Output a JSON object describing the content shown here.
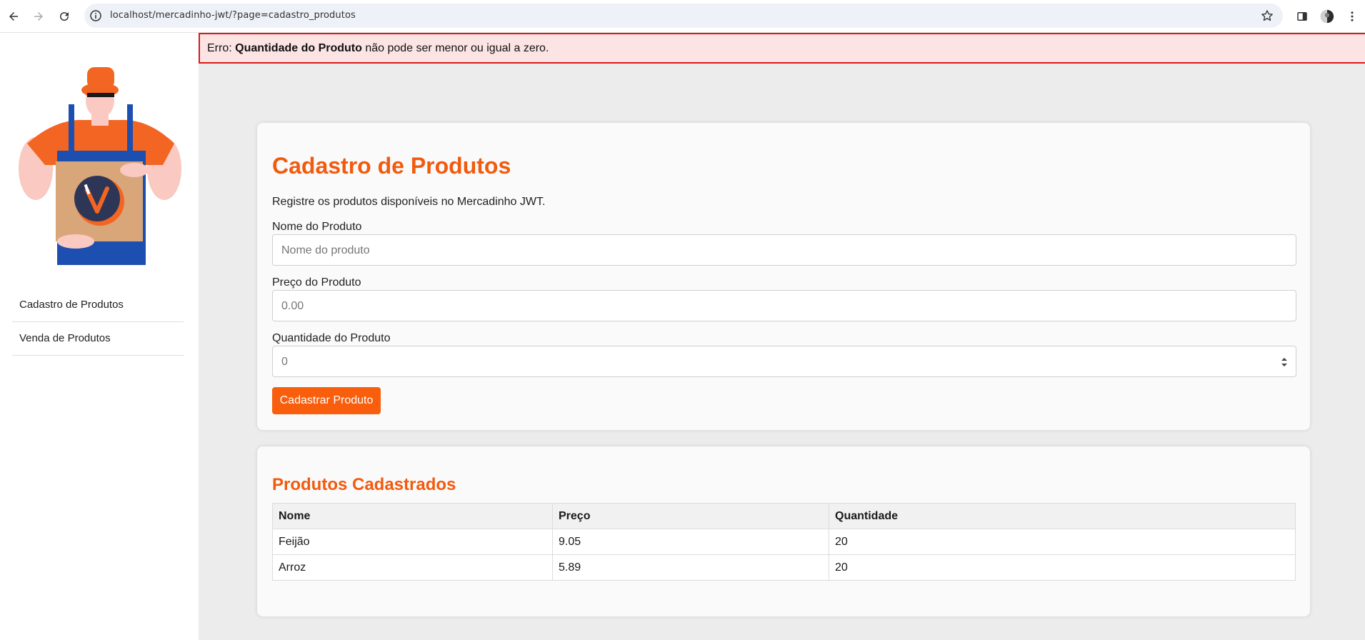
{
  "browser": {
    "url": "localhost/mercadinho-jwt/?page=cadastro_produtos"
  },
  "sidebar": {
    "items": [
      {
        "label": "Cadastro de Produtos"
      },
      {
        "label": "Venda de Produtos"
      }
    ]
  },
  "error": {
    "prefix": "Erro:",
    "field": "Quantidade do Produto",
    "message": "não pode ser menor ou igual a zero."
  },
  "form": {
    "title": "Cadastro de Produtos",
    "subtitle": "Registre os produtos disponíveis no Mercadinho JWT.",
    "name_label": "Nome do Produto",
    "name_placeholder": "Nome do produto",
    "price_label": "Preço do Produto",
    "price_placeholder": "0.00",
    "qty_label": "Quantidade do Produto",
    "qty_value": "0",
    "submit_label": "Cadastrar Produto"
  },
  "products": {
    "title": "Produtos Cadastrados",
    "headers": {
      "name": "Nome",
      "price": "Preço",
      "qty": "Quantidade"
    },
    "rows": [
      {
        "name": "Feijão",
        "price": "9.05",
        "qty": "20"
      },
      {
        "name": "Arroz",
        "price": "5.89",
        "qty": "20"
      }
    ]
  },
  "colors": {
    "accent": "#f25a0e",
    "button": "#f85e0c",
    "error_bg": "#fde4e4",
    "error_border": "#d9191a"
  }
}
